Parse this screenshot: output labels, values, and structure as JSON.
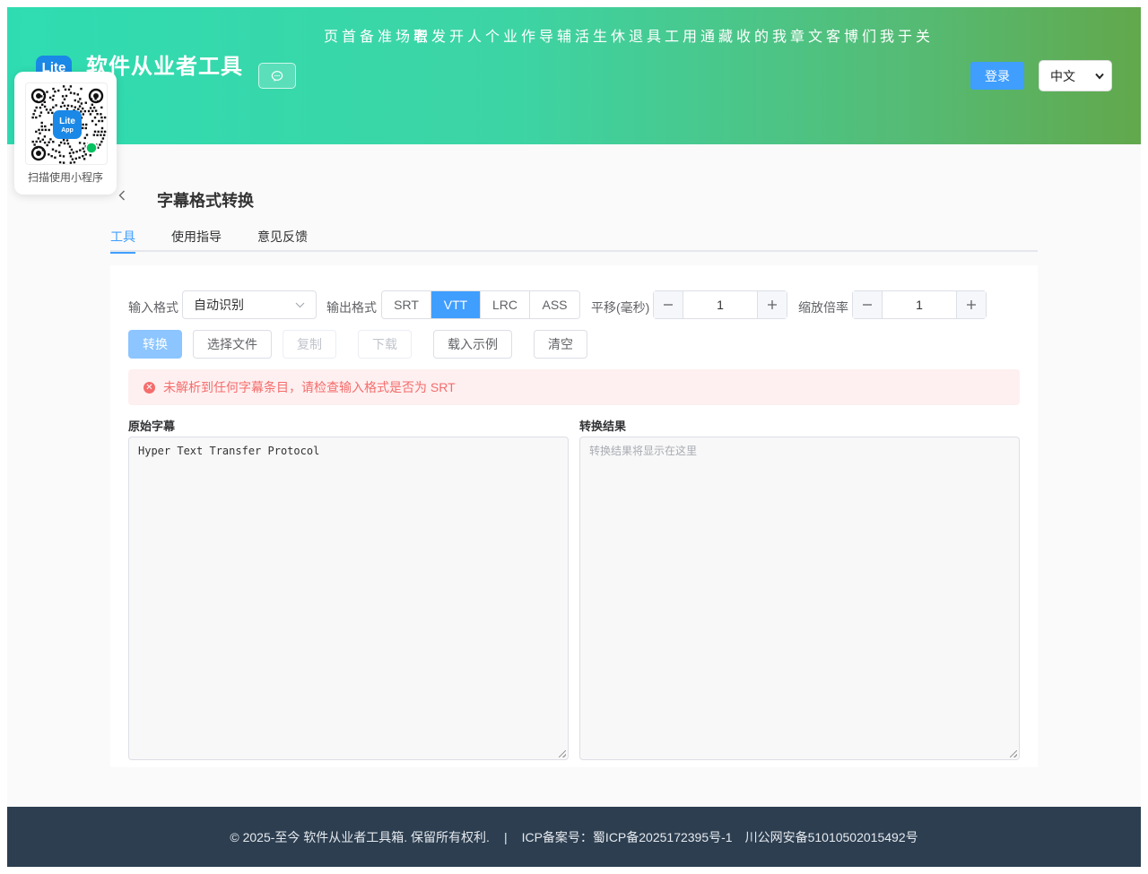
{
  "header": {
    "logo_text": "Lite",
    "brand": "软件从业者工具",
    "nav": [
      "首页",
      "职场准备",
      "个人开发者",
      "辅导作业",
      "退休生活",
      "通用工具",
      "我的收藏",
      "博客文章",
      "关于我们"
    ],
    "login": "登录",
    "language": "中文"
  },
  "qr": {
    "logo_line1": "Lite",
    "logo_line2": "App",
    "caption": "扫描使用小程序"
  },
  "page": {
    "title": "字幕格式转换"
  },
  "tabs": [
    "工具",
    "使用指导",
    "意见反馈"
  ],
  "options": {
    "input_format_label": "输入格式",
    "input_format_value": "自动识别",
    "output_format_label": "输出格式",
    "output_formats": [
      "SRT",
      "VTT",
      "LRC",
      "ASS"
    ],
    "selected_output": "VTT",
    "shift_label": "平移(毫秒)",
    "shift_value": "1",
    "scale_label": "缩放倍率",
    "scale_value": "1"
  },
  "actions": {
    "convert": "转换",
    "choose_file": "选择文件",
    "copy": "复制",
    "download": "下载",
    "load_example": "载入示例",
    "clear": "清空"
  },
  "alert": {
    "message": "未解析到任何字幕条目，请检查输入格式是否为 SRT"
  },
  "source": {
    "title": "原始字幕",
    "value": "Hyper Text Transfer Protocol"
  },
  "result": {
    "title": "转换结果",
    "placeholder": "转换结果将显示在这里"
  },
  "footer": {
    "copyright": "© 2025-至今 软件从业者工具箱. 保留所有权利.",
    "separator": "|",
    "icp": "ICP备案号：蜀ICP备2025172395号-1",
    "police": "川公网安备51010502015492号"
  },
  "colors": {
    "accent": "#409eff",
    "error": "#f56c6c",
    "footer": "#2c3e50",
    "header_start": "#2fdcb2",
    "header_end": "#62a84c"
  }
}
